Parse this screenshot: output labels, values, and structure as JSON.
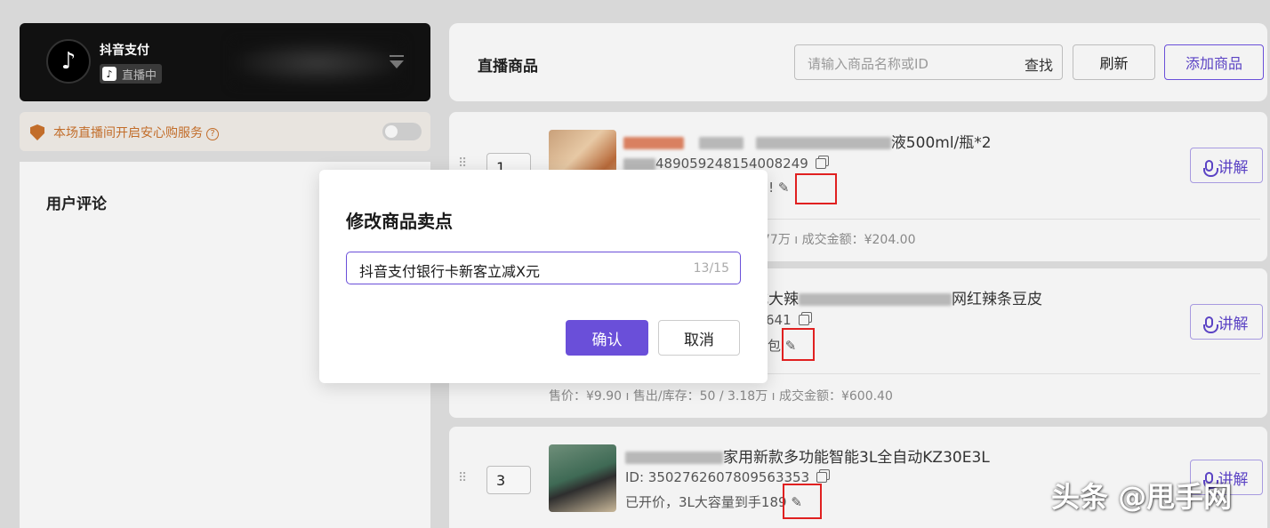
{
  "account": {
    "name": "抖音支付",
    "status": "直播中"
  },
  "safety": {
    "text": "本场直播间开启安心购服务",
    "help": "?"
  },
  "comments": {
    "title": "用户评论"
  },
  "products_header": {
    "title": "直播商品",
    "search_placeholder": "请输入商品名称或ID",
    "search_button": "查找",
    "refresh_button": "刷新",
    "add_button": "添加商品"
  },
  "products": [
    {
      "index": "1",
      "title_visible": "液500ml/瓶*2",
      "id_visible": "489059248154008249",
      "selling_point_visible": "68!",
      "stats_visible": "77万  ı  成交金额：¥204.00",
      "speak": "讲解"
    },
    {
      "index": "2",
      "title_prefix": "式大辣",
      "title_suffix": "网红辣条豆皮",
      "id_visible": "641",
      "selling_point_visible": "包",
      "stats": "售价：¥9.90  ı  售出/库存：50 / 3.18万  ı  成交金额：¥600.40",
      "speak": "讲解"
    },
    {
      "index": "3",
      "title_visible": "家用新款多功能智能3L全自动KZ30E3L",
      "id": "ID: 3502762607809563353",
      "selling_point": "已开价，3L大容量到手189",
      "speak": "讲解"
    }
  ],
  "modal": {
    "title": "修改商品卖点",
    "input_value": "抖音支付银行卡新客立减X元",
    "counter": "13/15",
    "confirm": "确认",
    "cancel": "取消"
  },
  "watermark": "头条 @甩手网",
  "colors": {
    "accent": "#6a4fd9",
    "highlight": "#e02020",
    "safety": "#c26d2a"
  }
}
